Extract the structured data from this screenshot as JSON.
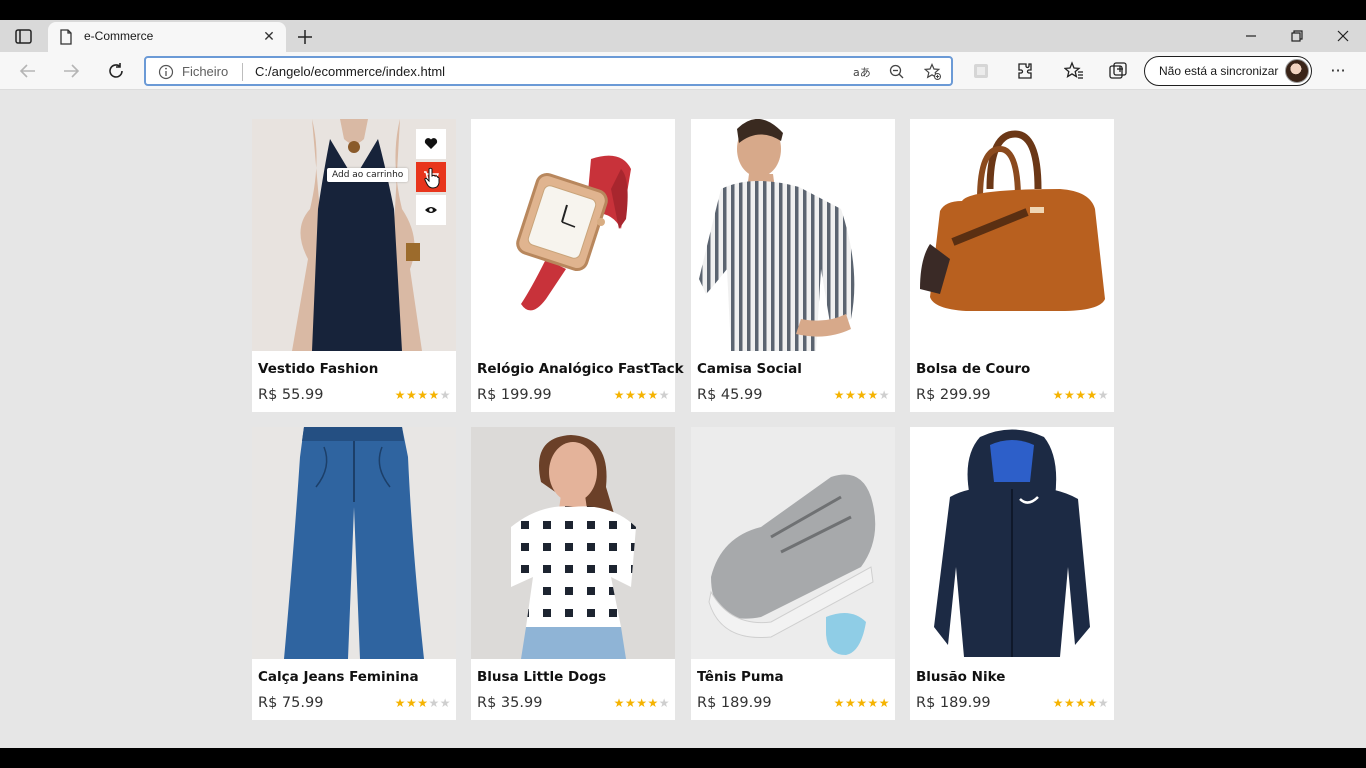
{
  "browser": {
    "tab": {
      "title": "e-Commerce",
      "close_glyph": "✕"
    },
    "address": {
      "scheme_label": "Ficheiro",
      "url": "C:/angelo/ecommerce/index.html"
    },
    "sync_label": "Não está a sincronizar",
    "more_glyph": "···"
  },
  "products": [
    {
      "name": "Vestido Fashion",
      "price": "R$ 55.99",
      "rating": 4
    },
    {
      "name": "Relógio Analógico FastTack",
      "price": "R$ 199.99",
      "rating": 4
    },
    {
      "name": "Camisa Social",
      "price": "R$ 45.99",
      "rating": 4
    },
    {
      "name": "Bolsa de Couro",
      "price": "R$ 299.99",
      "rating": 4
    },
    {
      "name": "Calça Jeans Feminina",
      "price": "R$ 75.99",
      "rating": 3
    },
    {
      "name": "Blusa Little Dogs",
      "price": "R$ 35.99",
      "rating": 4
    },
    {
      "name": "Tênis Puma",
      "price": "R$ 189.99",
      "rating": 5
    },
    {
      "name": "Blusão Nike",
      "price": "R$ 189.99",
      "rating": 4
    }
  ],
  "hover_actions": {
    "tooltip": "Add ao carrinho",
    "buttons": [
      "heart-icon",
      "cart-icon",
      "eye-icon"
    ],
    "active_color": "#e8351c"
  },
  "colors": {
    "star_on": "#f5b301",
    "star_off": "#cfcfcf",
    "page_bg": "#e6e6e6"
  }
}
